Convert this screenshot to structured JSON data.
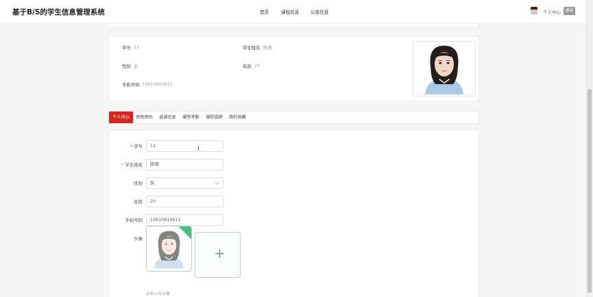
{
  "header": {
    "site_title": "基于B/S的学生信息管理系统",
    "nav": [
      "首页",
      "课程信息",
      "公告信息"
    ],
    "personal_center": "个人中心",
    "logout": "退出"
  },
  "profile": {
    "student_id_label": "学号",
    "student_id": "11",
    "name_label": "学生姓名",
    "name": "陈晓",
    "gender_label": "性别",
    "gender": "女",
    "age_label": "年龄",
    "age": "20",
    "phone_label": "手机号码",
    "phone": "15615615611"
  },
  "tabs": [
    "个人中心",
    "修改密码",
    "选课信息",
    "课堂考勤",
    "课程成绩",
    "我的收藏"
  ],
  "form": {
    "student_id_label": "学号",
    "student_id": "11",
    "name_label": "学生姓名",
    "name": "陈晓",
    "gender_label": "性别",
    "gender": "女",
    "age_label": "年龄",
    "age": "20",
    "phone_label": "手机号码",
    "phone": "15615615611",
    "avatar_label": "头像",
    "upload_hint": "点击上传头像",
    "cursor": "I"
  },
  "colors": {
    "accent": "#d6271f",
    "upload_success": "#45c37d"
  },
  "icons": {
    "upload": "plus-icon",
    "select": "chevron-down-icon"
  }
}
